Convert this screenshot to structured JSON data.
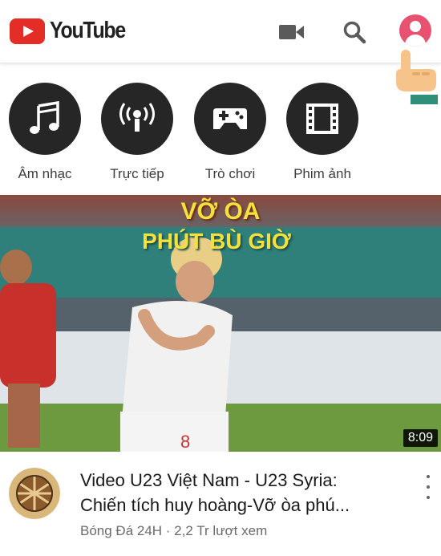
{
  "header": {
    "logo_text": "YouTube",
    "icons": [
      "video-camera-icon",
      "search-icon",
      "account-icon"
    ]
  },
  "categories": [
    {
      "label": "Âm nhạc",
      "icon": "music-note-icon"
    },
    {
      "label": "Trực tiếp",
      "icon": "live-broadcast-icon"
    },
    {
      "label": "Trò chơi",
      "icon": "gamepad-icon"
    },
    {
      "label": "Phim ảnh",
      "icon": "film-strip-icon"
    }
  ],
  "video": {
    "thumbnail_headline_1": "VỠ ÒA",
    "thumbnail_headline_2": "PHÚT BÙ GIỜ",
    "duration": "8:09",
    "title_line1": "Video U23 Việt Nam - U23 Syria:",
    "title_line2": "Chiến tích huy hoàng-Vỡ òa phú...",
    "meta": "Bóng Đá 24H · 2,2 Tr lượt xem"
  },
  "colors": {
    "brand_red": "#e52d27",
    "avatar_pink": "#e8516f",
    "headline_yellow": "#f4e23a"
  }
}
